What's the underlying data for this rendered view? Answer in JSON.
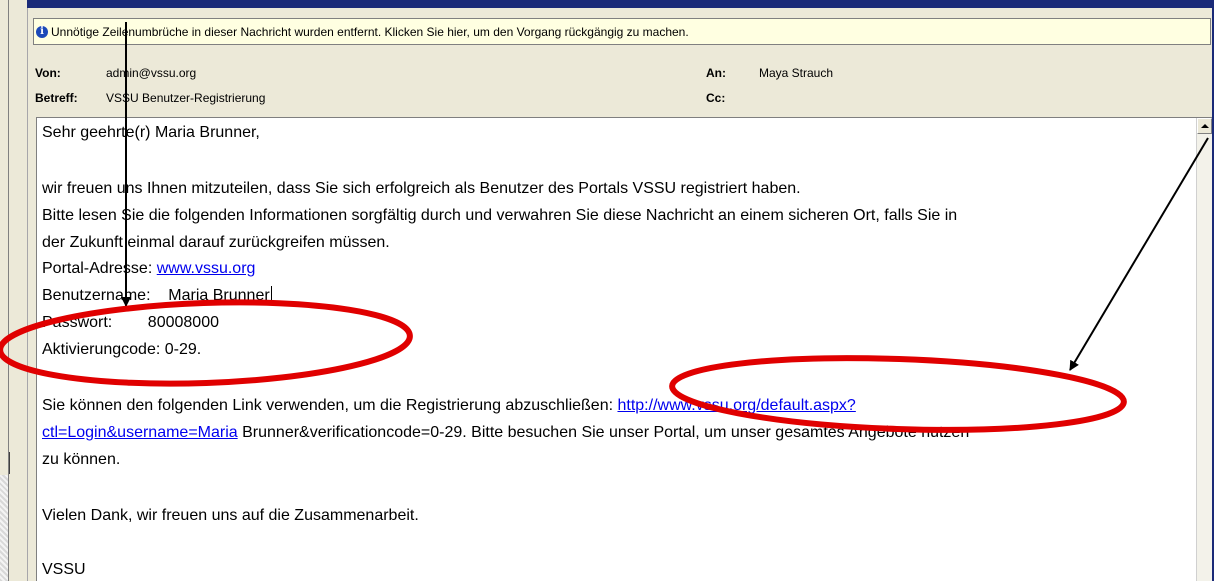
{
  "infobar": {
    "icon": "info-icon",
    "text": "Unnötige Zeilenumbrüche in dieser Nachricht wurden entfernt. Klicken Sie hier, um den Vorgang rückgängig zu machen."
  },
  "header": {
    "from_label": "Von:",
    "from_value": "admin@vssu.org",
    "subject_label": "Betreff:",
    "subject_value": "VSSU Benutzer-Registrierung",
    "to_label": "An:",
    "to_value": "Maya Strauch",
    "cc_label": "Cc:",
    "cc_value": ""
  },
  "body": {
    "greeting": "Sehr geehrte(r) Maria Brunner,",
    "para1_line1": "wir freuen uns Ihnen mitzuteilen, dass Sie sich erfolgreich als Benutzer des Portals  VSSU registriert haben.",
    "para1_line2": "Bitte lesen Sie die folgenden Informationen sorgfältig durch und verwahren Sie diese Nachricht an einem sicheren Ort, falls Sie  in",
    "para1_line3": "der Zukunft einmal darauf zurückgreifen müssen.",
    "portal_label": "Portal-Adresse:  ",
    "portal_link": "www.vssu.org",
    "username_line": "Benutzername:    Maria Brunner",
    "password_line": "Passwort:        80008000",
    "activation_line": "Aktivierungcode: 0-29.",
    "link_intro": "Sie können den folgenden Link verwenden, um die Registrierung abzuschließen: ",
    "link_part1": "http://www.vssu.org/default.aspx?",
    "link_part2": "ctl=Login&username=Maria",
    "link_rest": " Brunner&verificationcode=0-29. Bitte besuchen Sie unser Portal, um unser gesamtes Angebote nutzen",
    "link_line3": "zu können.",
    "thanks": "Vielen Dank, wir freuen uns auf die Zusammenarbeit.",
    "signature": "VSSU"
  },
  "annotations": {
    "color_ellipse": "#e00000",
    "color_arrow": "#000000"
  }
}
